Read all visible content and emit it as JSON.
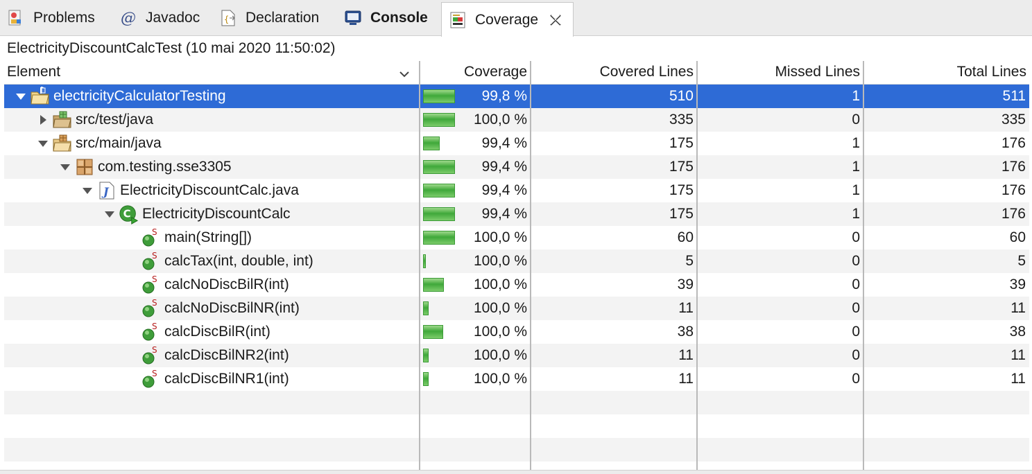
{
  "tabs": [
    {
      "label": "Problems",
      "icon": "problems-icon"
    },
    {
      "label": "Javadoc",
      "icon": "at-sign-icon"
    },
    {
      "label": "Declaration",
      "icon": "declaration-icon"
    },
    {
      "label": "Console",
      "icon": "console-icon"
    },
    {
      "label": "Coverage",
      "icon": "coverage-icon",
      "active": true
    }
  ],
  "session_title": "ElectricityDiscountCalcTest (10 mai 2020 11:50:02)",
  "columns": {
    "element": "Element",
    "coverage": "Coverage",
    "covered": "Covered Lines",
    "missed": "Missed Lines",
    "total": "Total Lines"
  },
  "rows": [
    {
      "name": "electricityCalculatorTesting",
      "level": 0,
      "expanded": true,
      "icon": "project-folder-icon",
      "coverage": "99,8 %",
      "coverage_fraction": 0.998,
      "covered": "510",
      "missed": "1",
      "total": "511",
      "selected": true
    },
    {
      "name": "src/test/java",
      "level": 1,
      "expanded": false,
      "icon": "source-folder-icon",
      "coverage": "100,0 %",
      "coverage_fraction": 1.0,
      "covered": "335",
      "missed": "0",
      "total": "335"
    },
    {
      "name": "src/main/java",
      "level": 1,
      "expanded": true,
      "icon": "source-folder-open-icon",
      "coverage": "99,4 %",
      "coverage_fraction": 0.994,
      "covered": "175",
      "missed": "1",
      "total": "176"
    },
    {
      "name": "com.testing.sse3305",
      "level": 2,
      "expanded": true,
      "icon": "package-icon",
      "coverage": "99,4 %",
      "coverage_fraction": 0.994,
      "covered": "175",
      "missed": "1",
      "total": "176"
    },
    {
      "name": "ElectricityDiscountCalc.java",
      "level": 3,
      "expanded": true,
      "icon": "java-file-icon",
      "coverage": "99,4 %",
      "coverage_fraction": 0.994,
      "covered": "175",
      "missed": "1",
      "total": "176"
    },
    {
      "name": "ElectricityDiscountCalc",
      "level": 4,
      "expanded": true,
      "icon": "class-icon",
      "coverage": "99,4 %",
      "coverage_fraction": 0.994,
      "covered": "175",
      "missed": "1",
      "total": "176"
    },
    {
      "name": "main(String[])",
      "level": 5,
      "icon": "static-method-icon",
      "coverage": "100,0 %",
      "coverage_fraction": 1.0,
      "covered": "60",
      "missed": "0",
      "total": "60"
    },
    {
      "name": "calcTax(int, double, int)",
      "level": 5,
      "icon": "static-method-icon",
      "coverage": "100,0 %",
      "coverage_fraction": 1.0,
      "covered": "5",
      "missed": "0",
      "total": "5"
    },
    {
      "name": "calcNoDiscBilR(int)",
      "level": 5,
      "icon": "static-method-icon",
      "coverage": "100,0 %",
      "coverage_fraction": 1.0,
      "covered": "39",
      "missed": "0",
      "total": "39"
    },
    {
      "name": "calcNoDiscBilNR(int)",
      "level": 5,
      "icon": "static-method-icon",
      "coverage": "100,0 %",
      "coverage_fraction": 1.0,
      "covered": "11",
      "missed": "0",
      "total": "11"
    },
    {
      "name": "calcDiscBilR(int)",
      "level": 5,
      "icon": "static-method-icon",
      "coverage": "100,0 %",
      "coverage_fraction": 1.0,
      "covered": "38",
      "missed": "0",
      "total": "38"
    },
    {
      "name": "calcDiscBilNR2(int)",
      "level": 5,
      "icon": "static-method-icon",
      "coverage": "100,0 %",
      "coverage_fraction": 1.0,
      "covered": "11",
      "missed": "0",
      "total": "11"
    },
    {
      "name": "calcDiscBilNR1(int)",
      "level": 5,
      "icon": "static-method-icon",
      "coverage": "100,0 %",
      "coverage_fraction": 1.0,
      "covered": "11",
      "missed": "0",
      "total": "11"
    }
  ],
  "colors": {
    "selection": "#2e6bd6",
    "bar_green": "#3fa83a",
    "row_alt": "#f3f3f3"
  }
}
